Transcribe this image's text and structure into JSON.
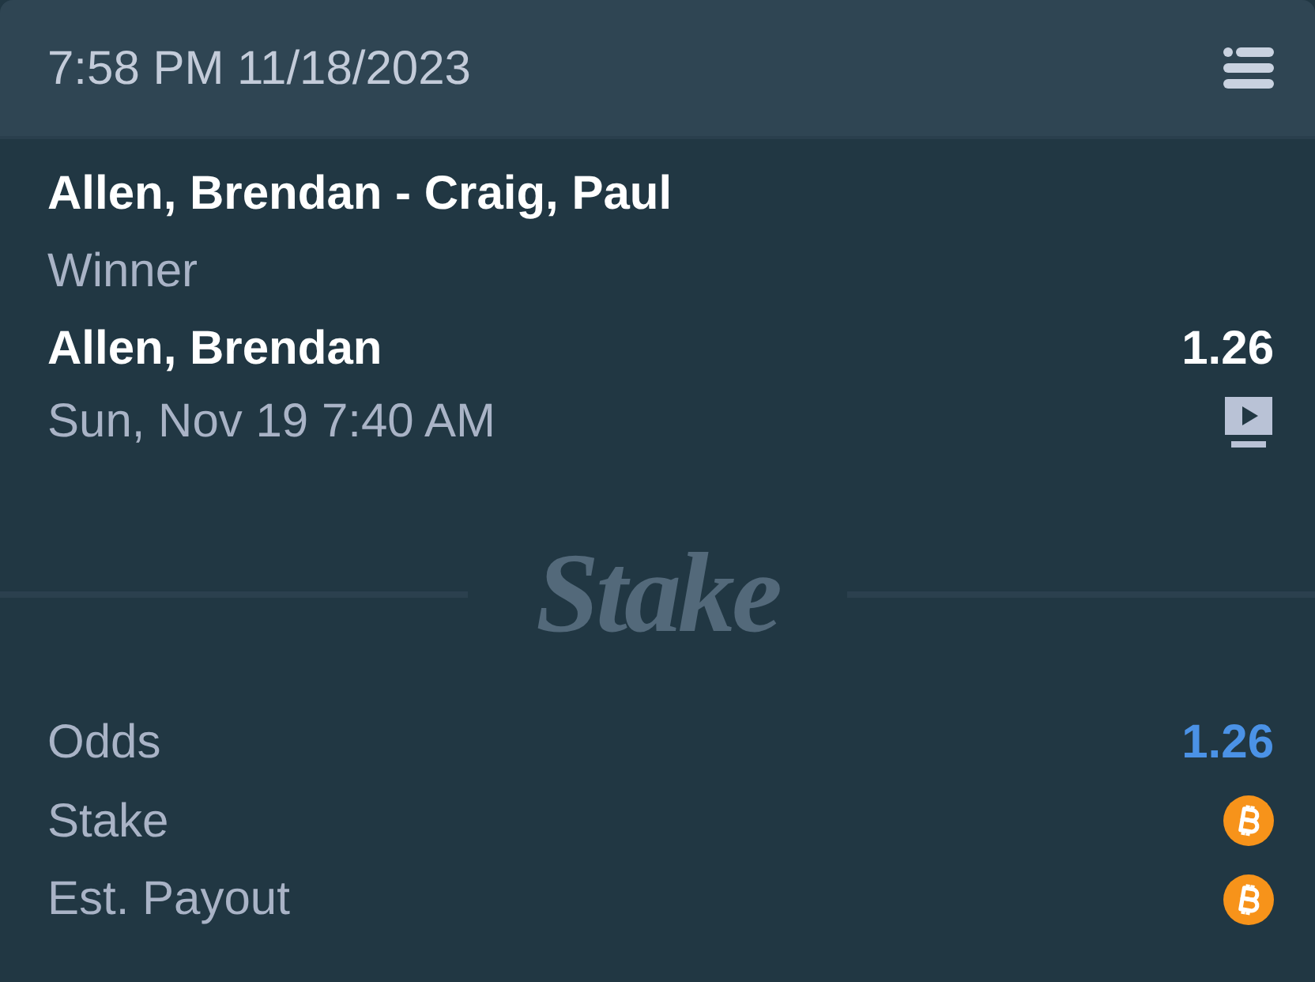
{
  "header": {
    "datetime": "7:58 PM 11/18/2023"
  },
  "bet": {
    "event": "Allen, Brendan - Craig, Paul",
    "market": "Winner",
    "selection": "Allen, Brendan",
    "odds": "1.26",
    "start_time": "Sun, Nov 19 7:40 AM"
  },
  "divider": {
    "logo": "Stake"
  },
  "summary": [
    {
      "label": "Odds",
      "kind": "odds",
      "value": "1.26"
    },
    {
      "label": "Stake",
      "kind": "coin"
    },
    {
      "label": "Est. Payout",
      "kind": "coin"
    }
  ]
}
